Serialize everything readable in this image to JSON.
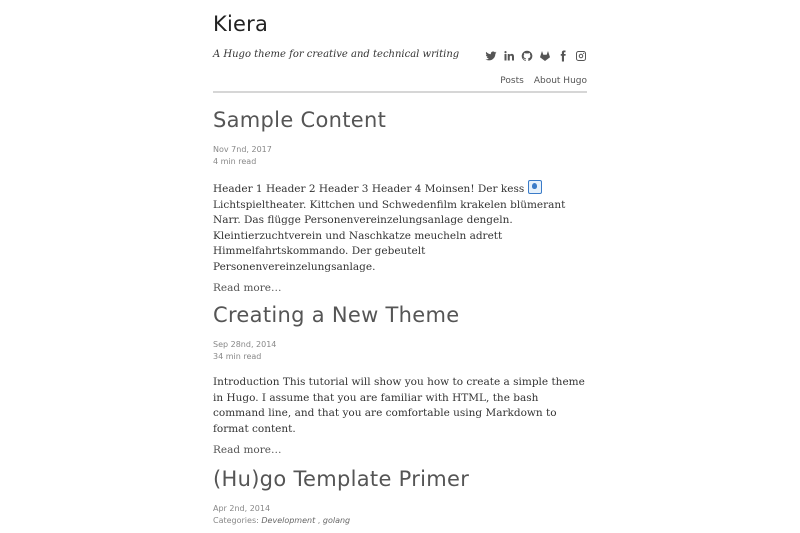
{
  "site": {
    "title": "Kiera",
    "description": "A Hugo theme for creative and technical writing"
  },
  "social": [
    {
      "icon": "twitter-icon"
    },
    {
      "icon": "linkedin-icon"
    },
    {
      "icon": "github-icon"
    },
    {
      "icon": "gitlab-icon"
    },
    {
      "icon": "facebook-icon"
    },
    {
      "icon": "instagram-icon"
    }
  ],
  "nav": {
    "posts": "Posts",
    "about": "About Hugo"
  },
  "posts": [
    {
      "title": "Sample Content",
      "date": "Nov 7nd, 2017",
      "reading_time": "4 min read",
      "summary_before_emoji": "Header 1 Header 2 Header 3 Header 4 Moinsen! Der kess ",
      "summary_after_emoji": " Lichtspieltheater. Kittchen und Schwedenfilm krakelen blümerant Narr. Das flügge Personenvereinzelungsanlage dengeln. Kleintierzuchtverein und Naschkatze meucheln adrett Himmelfahrtskommando. Der gebeutelt Personenvereinzelungsanlage.",
      "read_more": "Read more…"
    },
    {
      "title": "Creating a New Theme",
      "date": "Sep 28nd, 2014",
      "reading_time": "34 min read",
      "summary": "Introduction This tutorial will show you how to create a simple theme in Hugo. I assume that you are familiar with HTML, the bash command line, and that you are comfortable using Markdown to format content.",
      "read_more": "Read more…"
    },
    {
      "title": "(Hu)go Template Primer",
      "date": "Apr 2nd, 2014",
      "categories_label": "Categories:",
      "categories": [
        "Development",
        "golang"
      ],
      "categories_separator": " ,  "
    }
  ],
  "colors": {
    "title": "#222222",
    "post_title": "#555555",
    "meta": "#888888",
    "divider": "#d6d6d6",
    "icon": "#555555"
  }
}
